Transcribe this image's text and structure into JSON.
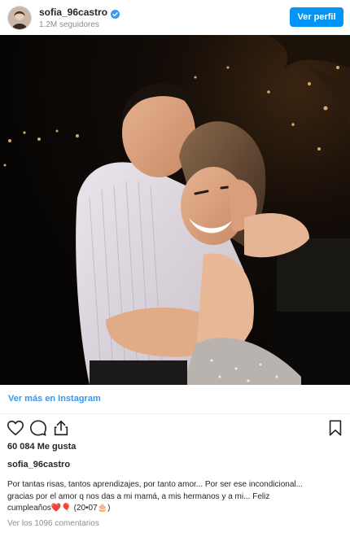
{
  "header": {
    "username": "sofia_96castro",
    "followers": "1.2M seguidores",
    "follow_button": "Ver perfil",
    "verified_icon": "verified-badge-icon"
  },
  "post": {
    "image_subject": "couple-embracing-night-photo",
    "view_more_link": "Ver más en Instagram",
    "likes": "60 084 Me gusta",
    "caption_user": "sofia_96castro",
    "caption_line1": "Por tantas risas, tantos aprendizajes, por tanto amor... Por ser ese incondicional...",
    "caption_line2": "gracias por el amor q nos das a mi mamá, a mis hermanos y a mi... Feliz",
    "caption_line3": "cumpleaños❤️🎈 (20•07🎂)",
    "comments_link": "Ver los 1096 comentarios"
  },
  "icons": {
    "like": "heart-icon",
    "comment": "comment-icon",
    "share": "share-icon",
    "save": "bookmark-icon"
  },
  "colors": {
    "accent": "#0095f6",
    "link": "#3897f0",
    "text": "#262626",
    "muted": "#8e8e8e"
  }
}
